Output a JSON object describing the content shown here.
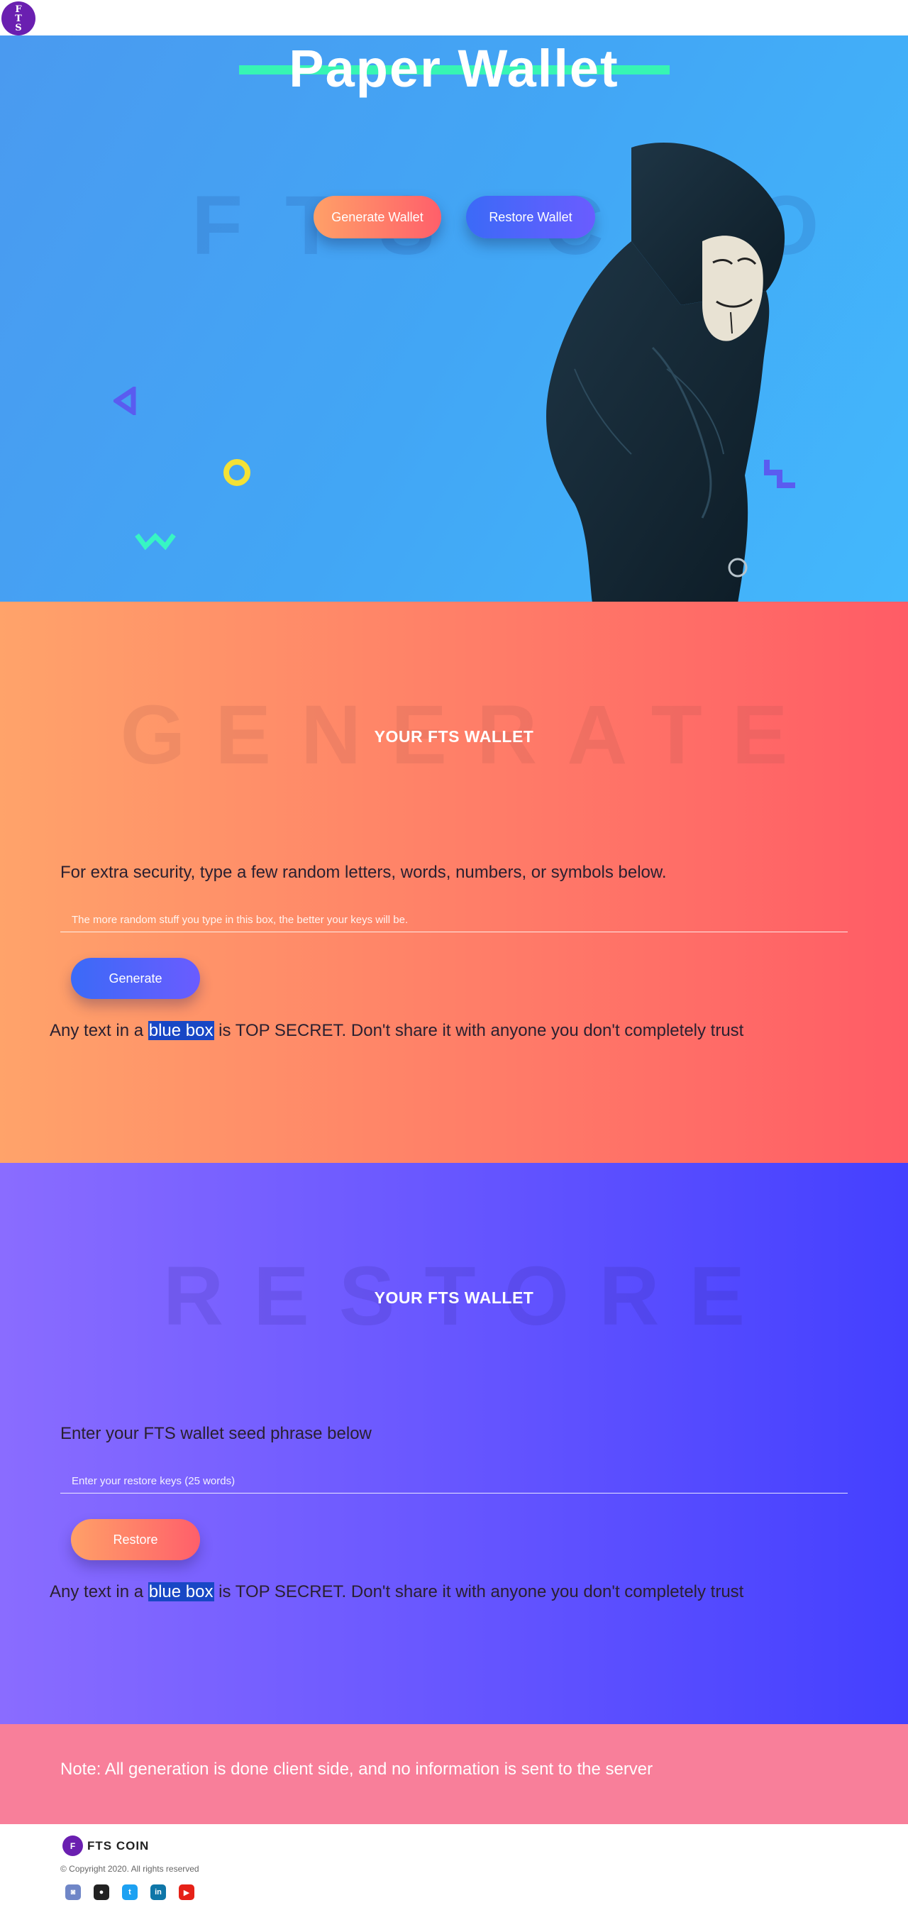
{
  "brand": {
    "badge_lines": [
      "F",
      "T",
      "S"
    ],
    "name": "FTS COIN"
  },
  "hero": {
    "title": "Paper Wallet",
    "watermark": "FTS COO",
    "generate_button": "Generate Wallet",
    "restore_button": "Restore Wallet"
  },
  "generate": {
    "watermark": "GENERATE",
    "heading": "YOUR FTS WALLET",
    "prompt": "For extra security, type a few random letters, words, numbers, or symbols below.",
    "input_placeholder": "The more random stuff you type in this box, the better your keys will be.",
    "input_value": "",
    "button": "Generate",
    "warning_before": "Any text in a ",
    "warning_highlight": "blue box",
    "warning_after": " is TOP SECRET. Don't share it with anyone you don't completely trust"
  },
  "restore": {
    "watermark": "RESTORE",
    "heading": "YOUR FTS WALLET",
    "prompt": "Enter your FTS wallet seed phrase below",
    "input_placeholder": "Enter your restore keys (25 words)",
    "input_value": "",
    "button": "Restore",
    "warning_before": "Any text in a ",
    "warning_highlight": "blue box",
    "warning_after": " is TOP SECRET. Don't share it with anyone you don't completely trust"
  },
  "note": {
    "text": "Note: All generation is done client side, and no information is sent to the server"
  },
  "footer": {
    "copyright": "© Copyright 2020. All rights reserved",
    "social": [
      {
        "icon": "discord-icon",
        "glyph": "◙"
      },
      {
        "icon": "github-icon",
        "glyph": "●"
      },
      {
        "icon": "twitter-icon",
        "glyph": "t"
      },
      {
        "icon": "linkedin-icon",
        "glyph": "in"
      },
      {
        "icon": "youtube-icon",
        "glyph": "▶"
      }
    ]
  },
  "colors": {
    "hero_blue": "#42a6f5",
    "accent_green": "#37f5b3",
    "orange": "#ffa36a",
    "coral": "#ff5c66",
    "purple": "#8a6cff",
    "indigo": "#4440ff",
    "pink": "#f87f9a",
    "secret_blue": "#1847c5",
    "brand_purple": "#6a1fb0"
  }
}
